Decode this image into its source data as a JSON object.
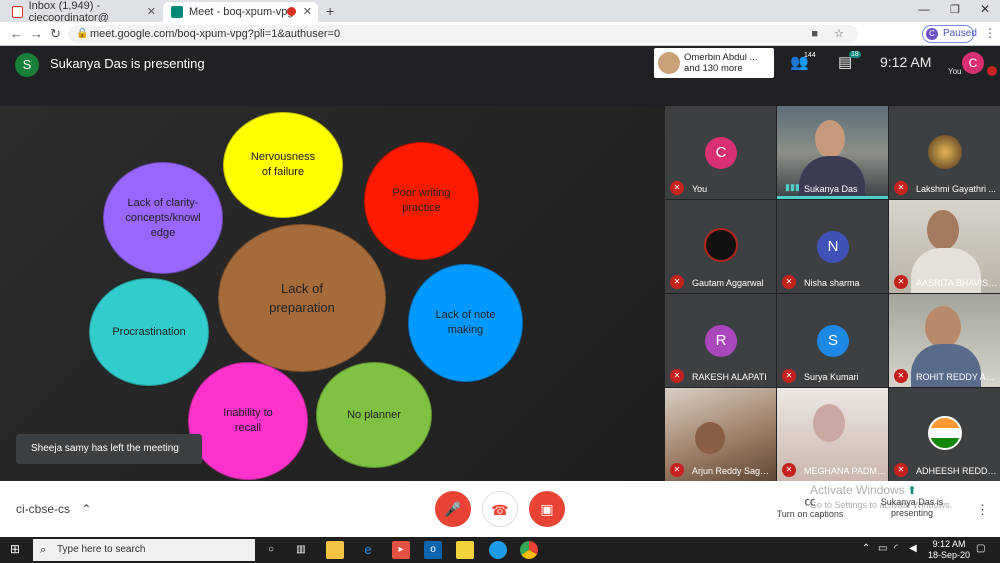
{
  "browser": {
    "tabs": [
      {
        "title": "Inbox (1,949) - ciecoordinator@",
        "icon": "gmail-icon"
      },
      {
        "title": "Meet - boq-xpum-vpg",
        "icon": "meet-icon",
        "recording": true
      }
    ],
    "url": "meet.google.com/boq-xpum-vpg?pli=1&authuser=0",
    "profile_initial": "C",
    "profile_status": "Paused"
  },
  "meet": {
    "presenter_initial": "S",
    "presenting_title": "Sukanya Das is presenting",
    "people_chip_line1": "Omerbin Abdul ...",
    "people_chip_line2": "and 130 more",
    "participant_count": "144",
    "chat_count": "18",
    "time": "9:12 AM",
    "self_initial": "C",
    "self_label": "You"
  },
  "slide": {
    "bubbles": [
      {
        "label": "Nervousness of failure",
        "color": "#ffff00"
      },
      {
        "label": "Poor writing practice",
        "color": "#ff1a00"
      },
      {
        "label": "Lack of clarity-concepts/knowledge",
        "color": "#9966ff"
      },
      {
        "label": "Lack of preparation",
        "color": "#a66b3a"
      },
      {
        "label": "Lack of note making",
        "color": "#0099ff"
      },
      {
        "label": "Procrastination",
        "color": "#33cccc"
      },
      {
        "label": "Inability to recall",
        "color": "#ff33cc"
      },
      {
        "label": "No planner",
        "color": "#7fc241"
      }
    ]
  },
  "toast": "Sheeja samy has left the meeting",
  "participants": [
    {
      "name": "You",
      "initial": "C",
      "color": "#d93075",
      "muted": true
    },
    {
      "name": "Sukanya Das",
      "video": true,
      "speaking": true
    },
    {
      "name": "Lakshmi Gayathri ...",
      "avatar": "image",
      "muted": true
    },
    {
      "name": "Gautam Aggarwal",
      "avatar": "logo",
      "muted": true
    },
    {
      "name": "Nisha sharma",
      "initial": "N",
      "color": "#3f51b5",
      "muted": true
    },
    {
      "name": "AASRITA BHAVISE...",
      "video": true,
      "muted": true
    },
    {
      "name": "RAKESH ALAPATI",
      "initial": "R",
      "color": "#ab47bc",
      "muted": true
    },
    {
      "name": "Surya Kumari",
      "initial": "S",
      "color": "#1e88e5",
      "muted": true
    },
    {
      "name": "ROHIT REDDY ARE",
      "video": true,
      "muted": true
    },
    {
      "name": "Arjun Reddy Sagga...",
      "video": true,
      "muted": true
    },
    {
      "name": "MEGHANA PADMA...",
      "video": true,
      "muted": true
    },
    {
      "name": "ADHEESH REDDY ...",
      "avatar": "flag",
      "muted": true
    }
  ],
  "bottom": {
    "meeting_code": "ci-cbse-cs",
    "captions_label": "Turn on captions",
    "presenting_label": "Sukanya Das is presenting",
    "activate_title": "Activate Windows",
    "activate_sub": "Go to Settings to activate Windows."
  },
  "taskbar": {
    "search_placeholder": "Type here to search",
    "time": "9:12 AM",
    "date": "18-Sep-20"
  },
  "colors": {
    "mic_off": "#c5221f",
    "end_call": "#ea4335",
    "speaking": "#4ecdc4"
  }
}
